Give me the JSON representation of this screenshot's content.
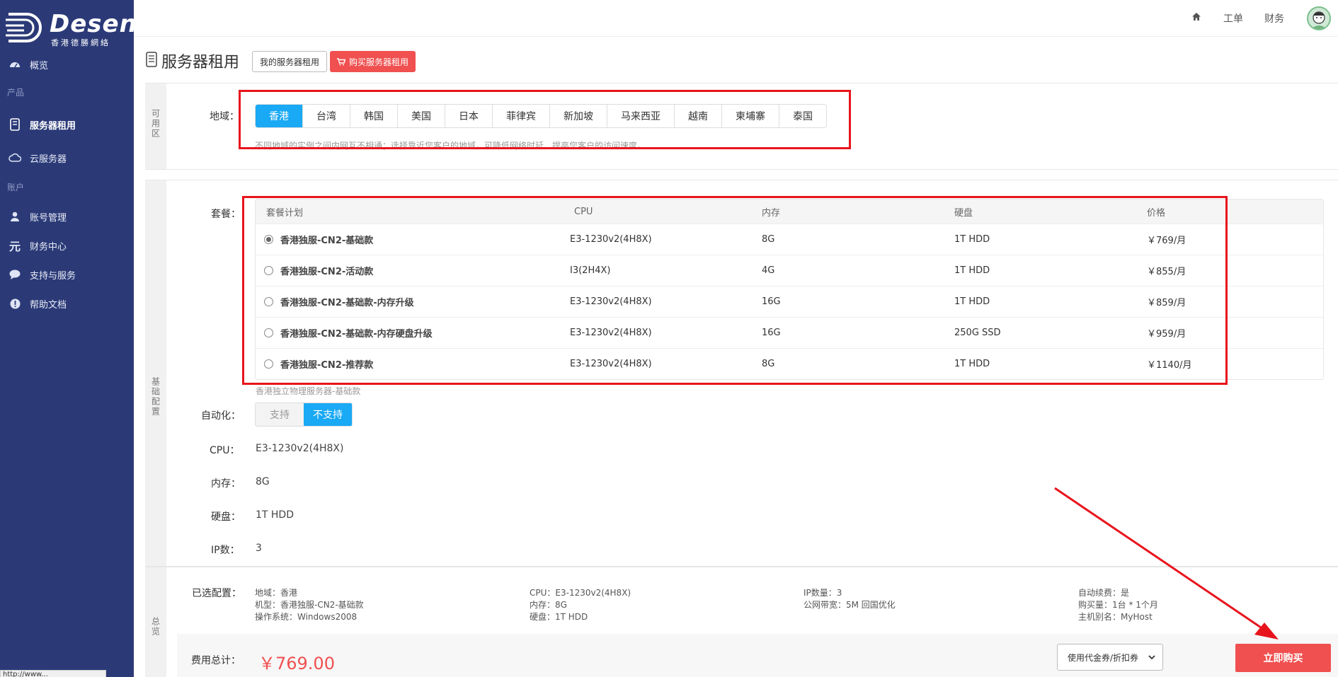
{
  "brand": {
    "name": "Desen",
    "sub": "香港德勝網絡"
  },
  "sidebar": {
    "items": [
      {
        "label": "概览",
        "icon": "dashboard-icon"
      },
      {
        "group": "产品"
      },
      {
        "label": "服务器租用",
        "icon": "server-icon",
        "active": true
      },
      {
        "label": "云服务器",
        "icon": "cloud-icon"
      },
      {
        "group": "账户"
      },
      {
        "label": "账号管理",
        "icon": "user-icon"
      },
      {
        "label": "财务中心",
        "icon": "yuan-icon"
      },
      {
        "label": "支持与服务",
        "icon": "chat-icon"
      },
      {
        "label": "帮助文档",
        "icon": "info-icon"
      }
    ]
  },
  "topbar": {
    "home_icon": "home-icon",
    "ticket": "工单",
    "finance": "财务"
  },
  "page": {
    "title": "服务器租用",
    "my_rental_btn": "我的服务器租用",
    "buy_rental_btn": "购买服务器租用"
  },
  "region_panel": {
    "side_label": "可用区",
    "label": "地域：",
    "regions": [
      "香港",
      "台湾",
      "韩国",
      "美国",
      "日本",
      "菲律宾",
      "新加坡",
      "马来西亚",
      "越南",
      "柬埔寨",
      "泰国"
    ],
    "selected": "香港",
    "hint": "不同地域的实例之间内网互不相通；选择靠近您客户的地域，可降低网络时延、提高您客户的访问速度。"
  },
  "config_panel": {
    "side_label": "基础配置",
    "plan_label": "套餐：",
    "columns": [
      "套餐计划",
      "CPU",
      "内存",
      "硬盘",
      "价格"
    ],
    "plans": [
      {
        "name": "香港独服-CN2-基础款",
        "cpu": "E3-1230v2(4H8X)",
        "mem": "8G",
        "disk": "1T HDD",
        "price": "￥769/月",
        "checked": true
      },
      {
        "name": "香港独服-CN2-活动款",
        "cpu": "I3(2H4X)",
        "mem": "4G",
        "disk": "1T HDD",
        "price": "￥855/月",
        "checked": false
      },
      {
        "name": "香港独服-CN2-基础款-内存升级",
        "cpu": "E3-1230v2(4H8X)",
        "mem": "16G",
        "disk": "1T HDD",
        "price": "￥859/月",
        "checked": false
      },
      {
        "name": "香港独服-CN2-基础款-内存硬盘升级",
        "cpu": "E3-1230v2(4H8X)",
        "mem": "16G",
        "disk": "250G SSD",
        "price": "￥959/月",
        "checked": false
      },
      {
        "name": "香港独服-CN2-推荐款",
        "cpu": "E3-1230v2(4H8X)",
        "mem": "8G",
        "disk": "1T HDD",
        "price": "￥1140/月",
        "checked": false
      }
    ],
    "plan_desc": "香港独立物理服务器-基础款",
    "automation_label": "自动化：",
    "automation_options": [
      "支持",
      "不支持"
    ],
    "automation_selected": "不支持",
    "cpu_label": "CPU：",
    "cpu_value": "E3-1230v2(4H8X)",
    "mem_label": "内存：",
    "mem_value": "8G",
    "disk_label": "硬盘：",
    "disk_value": "1T HDD",
    "ip_label": "IP数：",
    "ip_value": "3"
  },
  "summary": {
    "side_label": "总览",
    "selected_label": "已选配置：",
    "col1": [
      "地域：香港",
      "机型：香港独服-CN2-基础款",
      "操作系统：Windows2008"
    ],
    "col2": [
      "CPU：E3-1230v2(4H8X)",
      "内存：8G",
      "硬盘：1T HDD"
    ],
    "col3": [
      "IP数量：3",
      "公网带宽：5M 回国优化"
    ],
    "col4": [
      "自动续费：是",
      "购买量：1台 * 1个月",
      "主机别名：MyHost"
    ],
    "total_label": "费用总计：",
    "total_price": "￥769.00",
    "coupon_placeholder": "使用代金券/折扣券",
    "buy_now": "立即购买"
  },
  "status_url": "http://www..."
}
